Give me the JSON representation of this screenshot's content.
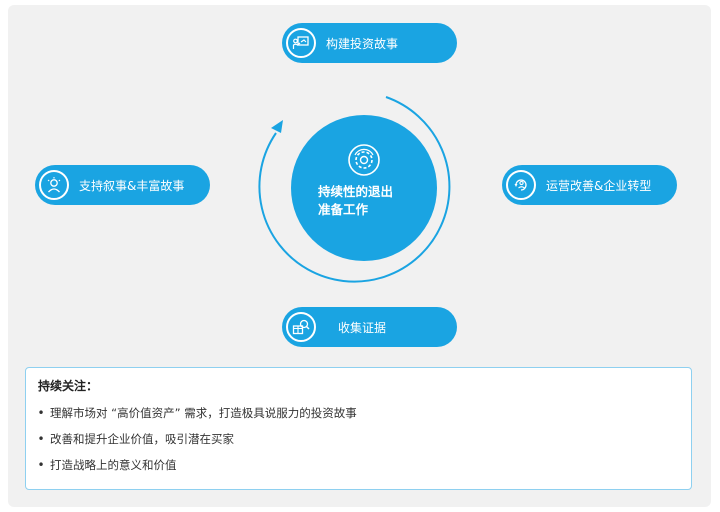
{
  "colors": {
    "accent": "#1aa4e2",
    "panel_bg": "#f1f1f1",
    "box_border": "#8ed0f0"
  },
  "center": {
    "icon": "gear-refresh-icon",
    "title_line1": "持续性的退出",
    "title_line2": "准备工作"
  },
  "nodes": {
    "top": {
      "label": "构建投资故事",
      "icon": "presentation-icon"
    },
    "left": {
      "label": "支持叙事&丰富故事",
      "icon": "lightbulb-person-icon"
    },
    "right": {
      "label": "运营改善&企业转型",
      "icon": "person-cycle-icon"
    },
    "bottom": {
      "label": "收集证据",
      "icon": "magnifier-box-icon"
    }
  },
  "focus": {
    "title": "持续关注：",
    "items": [
      "理解市场对 “高价值资产” 需求，打造极具说服力的投资故事",
      "改善和提升企业价值，吸引潜在买家",
      "打造战略上的意义和价值"
    ]
  }
}
